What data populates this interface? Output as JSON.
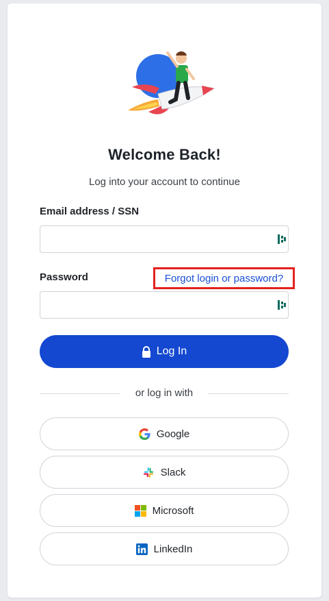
{
  "header": {
    "title": "Welcome Back!",
    "subtitle": "Log into your account to continue"
  },
  "form": {
    "email_label": "Email address / SSN",
    "email_value": "",
    "password_label": "Password",
    "password_value": "",
    "forgot_link": "Forgot login or password?",
    "login_button": "Log In"
  },
  "divider_text": "or log in with",
  "sso": [
    {
      "label": "Google",
      "icon": "google-icon"
    },
    {
      "label": "Slack",
      "icon": "slack-icon"
    },
    {
      "label": "Microsoft",
      "icon": "microsoft-icon"
    },
    {
      "label": "LinkedIn",
      "icon": "linkedin-icon"
    }
  ],
  "colors": {
    "primary": "#1448d0",
    "link": "#1a4fd6",
    "highlight": "#e5201d",
    "background": "#e9ebef"
  }
}
